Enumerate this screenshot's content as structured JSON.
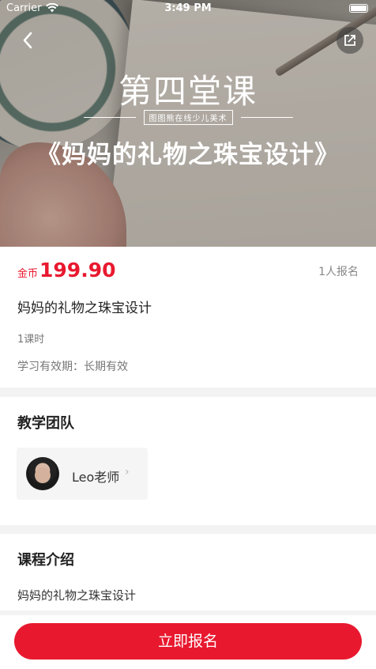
{
  "status_bar": {
    "carrier": "Carrier",
    "time": "3:49 PM"
  },
  "hero": {
    "title": "第四堂课",
    "tag": "图图熊在线少儿美术",
    "subtitle": "《妈妈的礼物之珠宝设计》"
  },
  "course": {
    "currency": "金币",
    "price": "199.90",
    "enroll_count": "1人报名",
    "title": "妈妈的礼物之珠宝设计",
    "lessons": "1课时",
    "validity": "学习有效期：长期有效"
  },
  "team": {
    "title": "教学团队",
    "teacher_name": "Leo老师",
    "chevron": "›"
  },
  "intro": {
    "title": "课程介绍",
    "text": "妈妈的礼物之珠宝设计"
  },
  "cta": {
    "label": "立即报名"
  },
  "icons": {
    "back": "chevron-left-icon",
    "share": "share-icon",
    "wifi": "wifi-icon",
    "battery": "battery-icon"
  },
  "colors": {
    "accent": "#e8192f"
  }
}
